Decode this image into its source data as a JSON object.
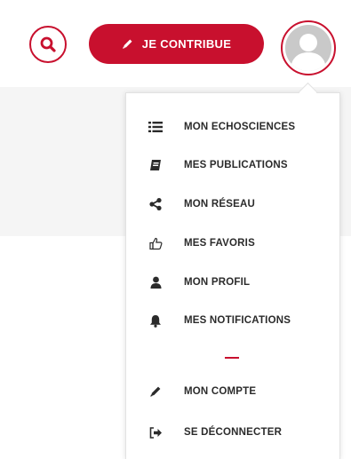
{
  "header": {
    "search_icon": "search-icon",
    "contribute_label": "JE CONTRIBUE",
    "contribute_icon": "pencil-icon",
    "avatar": "user-avatar"
  },
  "menu": {
    "items": [
      {
        "label": "MON ECHOSCIENCES",
        "icon": "list-icon"
      },
      {
        "label": "MES PUBLICATIONS",
        "icon": "book-icon"
      },
      {
        "label": "MON RÉSEAU",
        "icon": "share-icon"
      },
      {
        "label": "MES FAVORIS",
        "icon": "thumbs-up-icon"
      },
      {
        "label": "MON PROFIL",
        "icon": "user-icon"
      },
      {
        "label": "MES NOTIFICATIONS",
        "icon": "bell-icon"
      },
      {
        "label": "MON COMPTE",
        "icon": "pencil-icon"
      },
      {
        "label": "SE DÉCONNECTER",
        "icon": "sign-out-icon"
      }
    ]
  },
  "colors": {
    "accent": "#c8102e",
    "text": "#2b2b2b",
    "background_panel": "#f5f5f5"
  }
}
